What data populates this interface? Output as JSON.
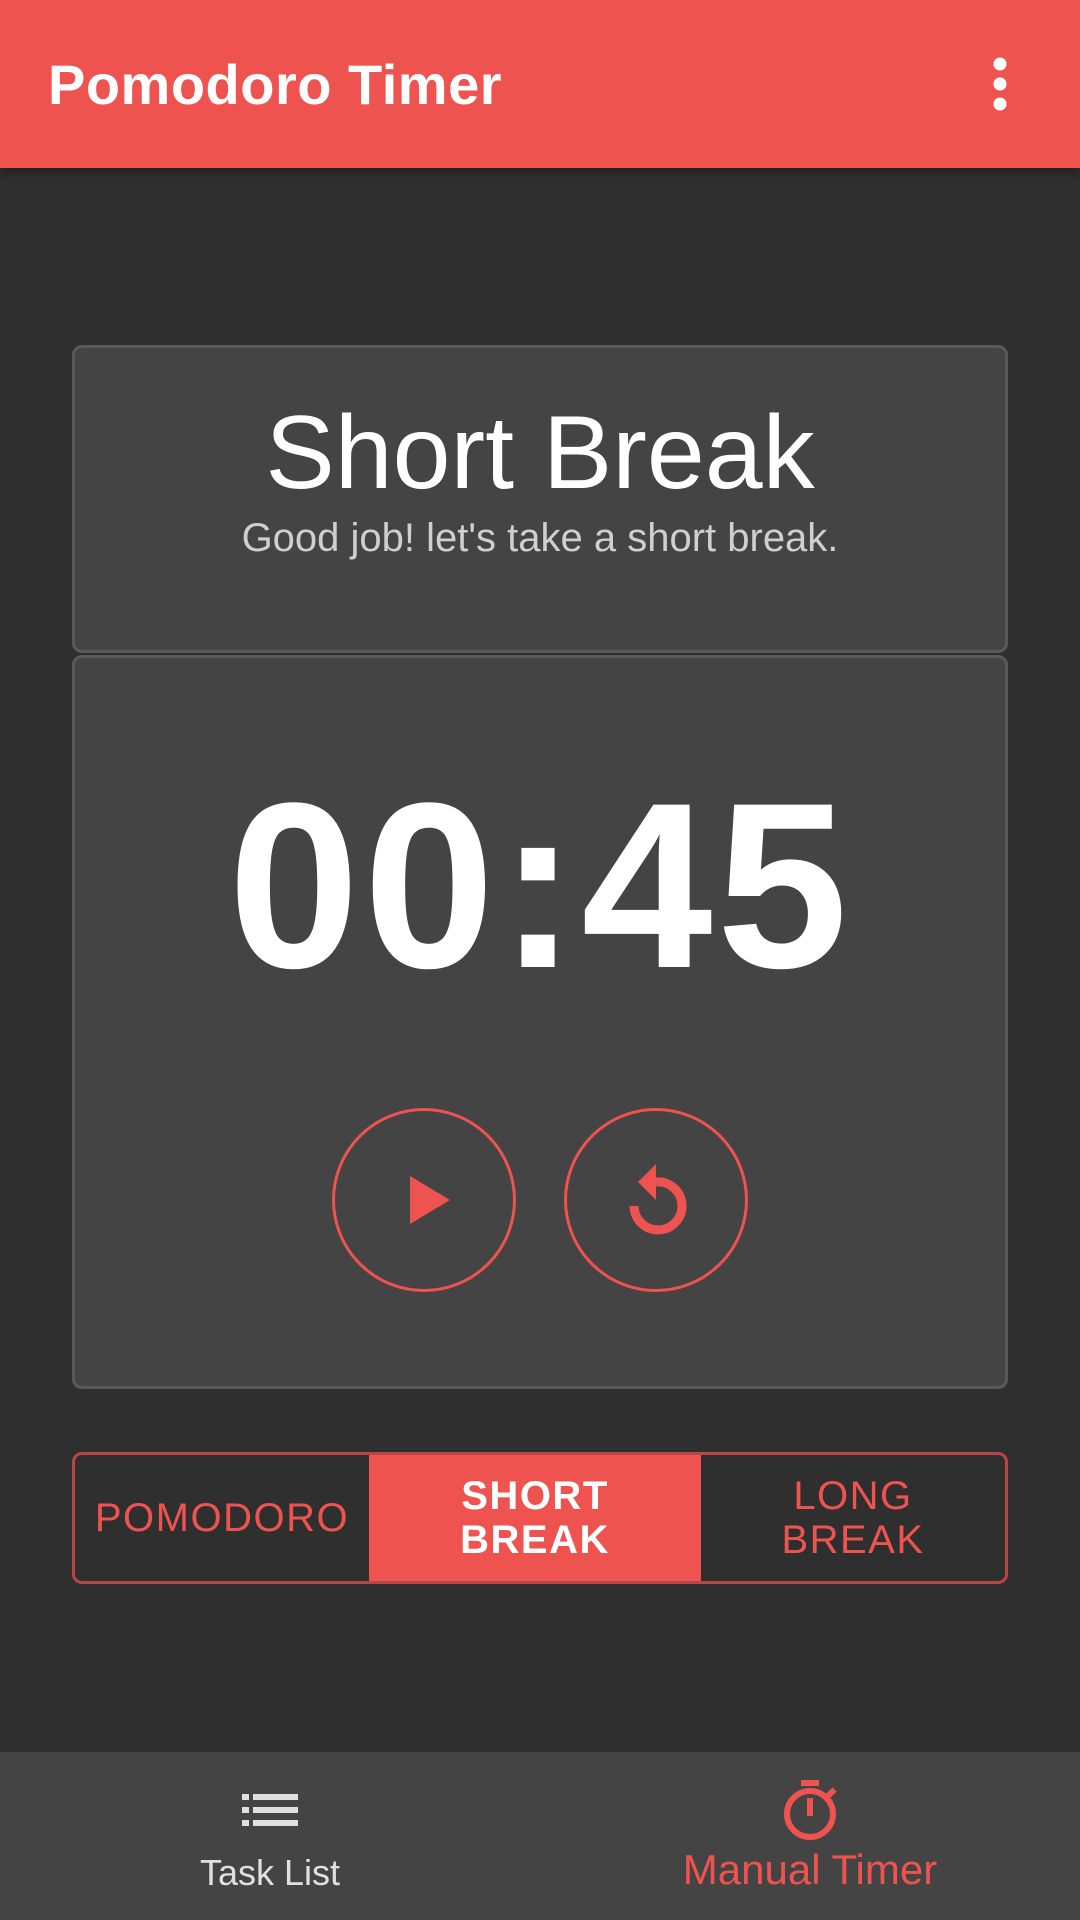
{
  "app": {
    "title": "Pomodoro Timer",
    "menu_icon": "more-vert-icon",
    "accent_color": "#ef5350",
    "background_color": "#2f2f2f"
  },
  "session": {
    "title": "Short Break",
    "subtitle": "Good job! let's take a short break."
  },
  "timer": {
    "display": "00:45",
    "play_icon": "play-icon",
    "reset_icon": "reset-icon"
  },
  "modes": [
    {
      "label": "POMODORO",
      "active": false
    },
    {
      "label": "SHORT BREAK",
      "active": true
    },
    {
      "label": "LONG BREAK",
      "active": false
    }
  ],
  "bottom_nav": [
    {
      "label": "Task List",
      "icon": "list-icon",
      "active": false
    },
    {
      "label": "Manual Timer",
      "icon": "stopwatch-icon",
      "active": true
    }
  ]
}
